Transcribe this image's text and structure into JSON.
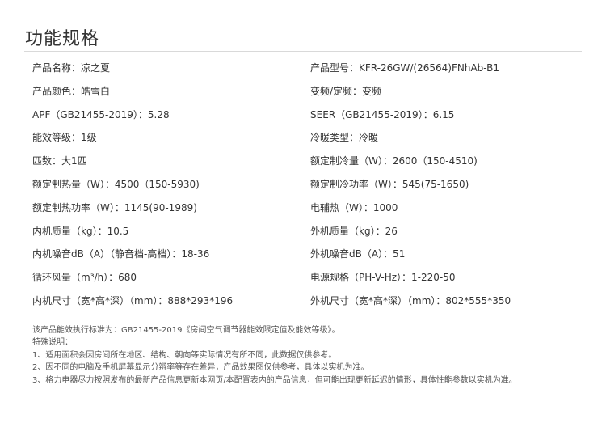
{
  "header": {
    "title": "功能规格"
  },
  "specs": [
    {
      "left": "产品名称：凉之夏",
      "right": "产品型号：KFR-26GW/(26564)FNhAb-B1"
    },
    {
      "left": "产品颜色：皓雪白",
      "right": "变频/定频：变频"
    },
    {
      "left": "APF（GB21455-2019）：5.28",
      "right": "SEER（GB21455-2019）：6.15"
    },
    {
      "left": "能效等级：1级",
      "right": "冷暖类型：冷暖"
    },
    {
      "left": "匹数：大1匹",
      "right": "额定制冷量（W）：2600（150-4510)"
    },
    {
      "left": "额定制热量（W）：4500（150-5930)",
      "right": "额定制冷功率（W）：545(75-1650)"
    },
    {
      "left": "额定制热功率（W）：1145(90-1989)",
      "right": "电辅热（W）：1000"
    },
    {
      "left": "内机质量（kg）：10.5",
      "right": "外机质量（kg）：26"
    },
    {
      "left": "内机噪音dB（A）（静音档-高档）：18-36",
      "right": "外机噪音dB（A）：51"
    },
    {
      "left": "循环风量（m³/h）：680",
      "right": "电源规格（PH-V-Hz）：1-220-50"
    },
    {
      "left": "内机尺寸（宽*高*深）（mm）：888*293*196",
      "right": "外机尺寸（宽*高*深）（mm）：802*555*350"
    }
  ],
  "notes": {
    "standard": "该产品能效执行标准为：GB21455-2019《房间空气调节器能效限定值及能效等级》。",
    "heading": "特殊说明：",
    "items": [
      "1、适用面积会因房间所在地区、结构、朝向等实际情况有所不同，此数据仅供参考。",
      "2、因不同的电脑及手机屏幕显示分辨率等存在差异，产品效果图仅供参考，具体以实机为准。",
      "3、格力电器尽力按照发布的最新产品信息更新本网页/本配置表内的产品信息，但可能出现更新延迟的情形，具体性能参数以实机为准。"
    ]
  }
}
